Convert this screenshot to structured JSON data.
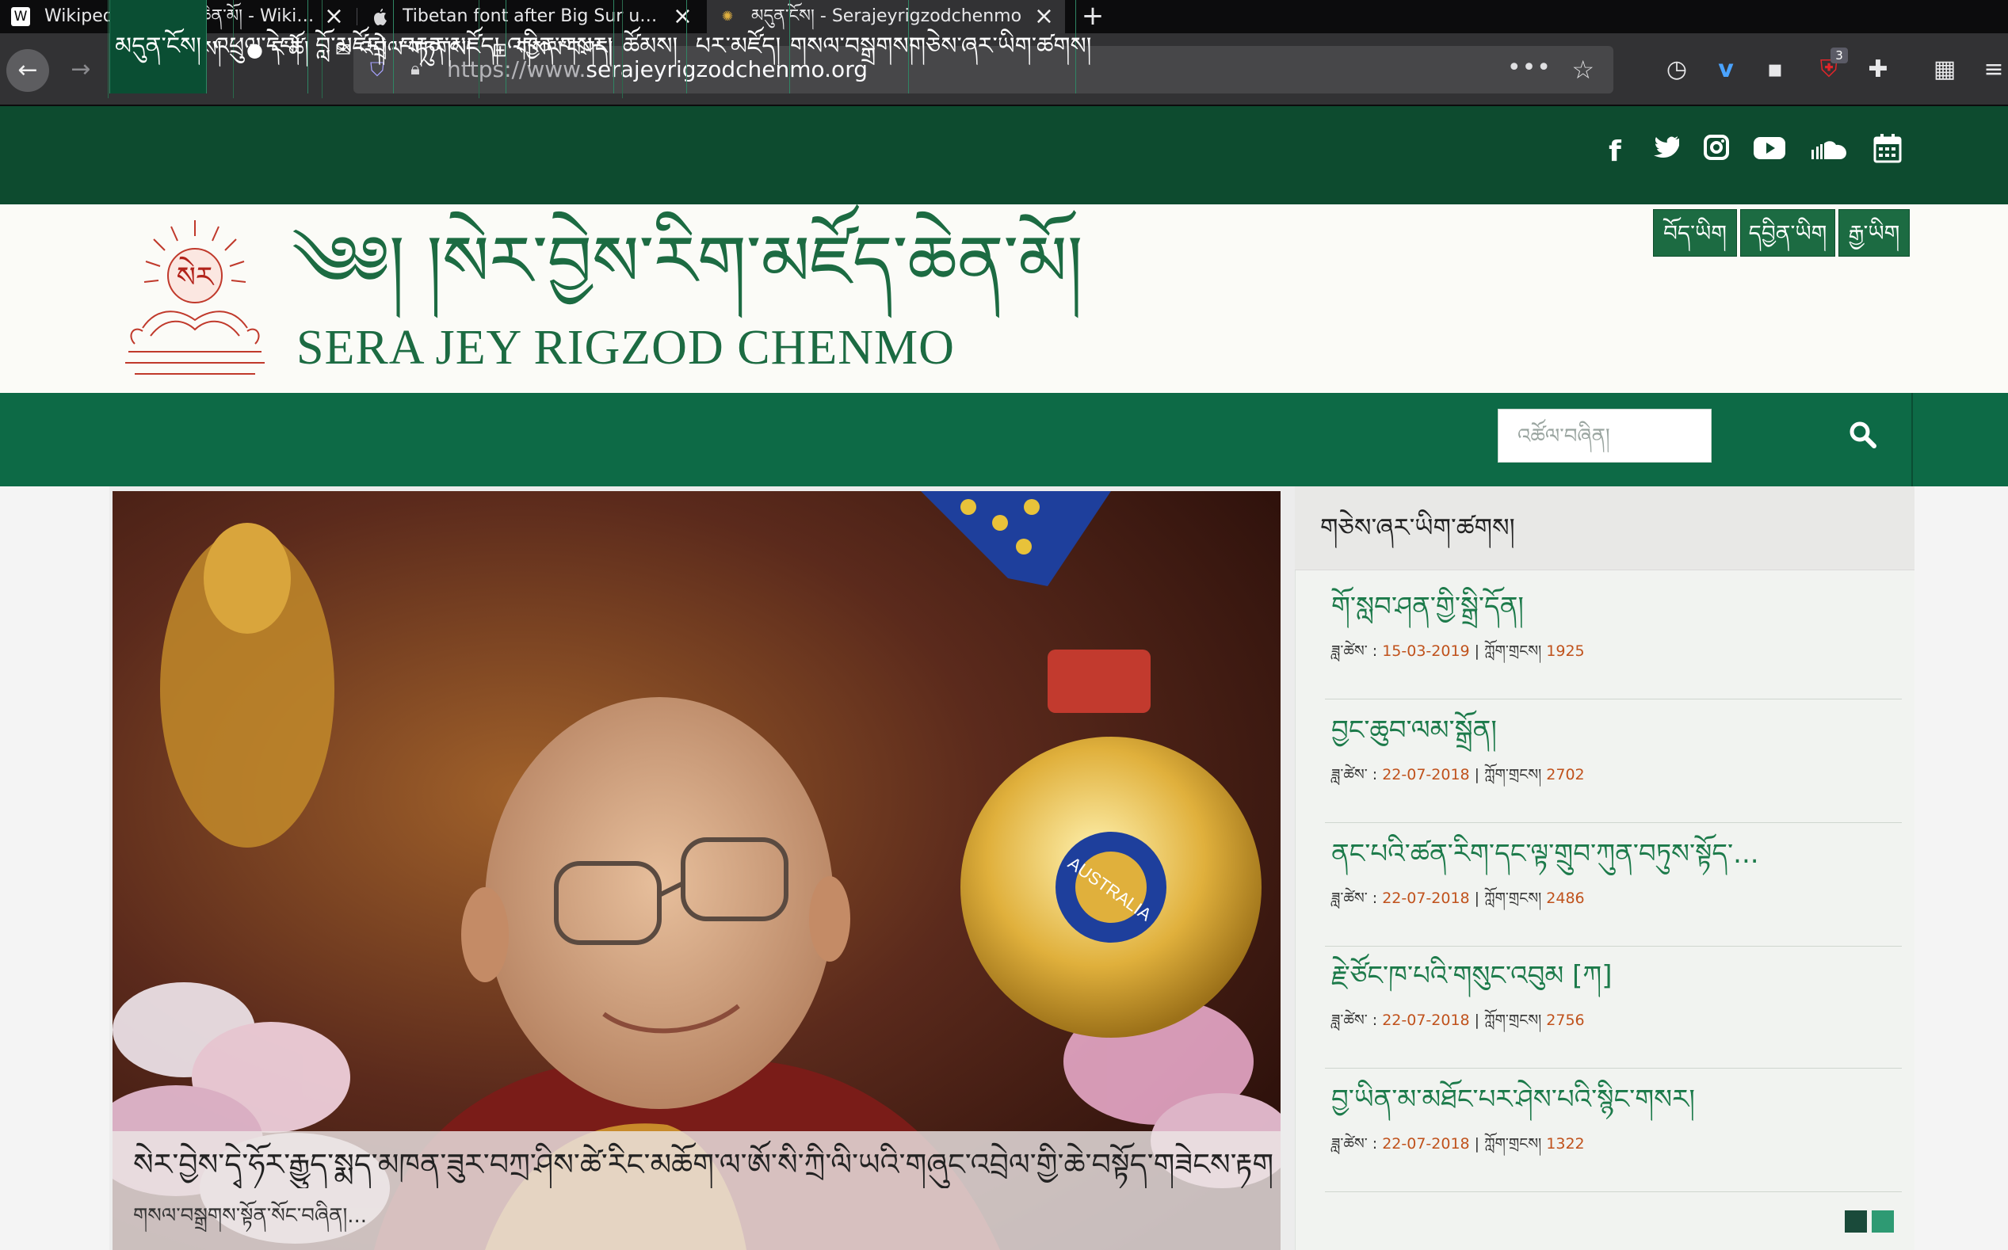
{
  "browser": {
    "tabs": [
      {
        "icon": "wikipedia-icon",
        "favicon_glyph": "W",
        "title": "Wikipedia:རིག་མཛོད་ཆེན་མོ། - Wikipedia",
        "active": false
      },
      {
        "icon": "apple-icon",
        "favicon_glyph": "",
        "title": "Tibetan font after Big Sur update",
        "active": false
      },
      {
        "icon": "sera-monastery-icon",
        "favicon_glyph": "✺",
        "title": "མདུན་ངོས། - Serajeyrigzodchenmo",
        "active": true
      }
    ],
    "new_tab_symbol": "+",
    "url_protocol": "https://www.",
    "url_domain": "serajeyrigzodchenmo.org",
    "extension_badge": "3"
  },
  "site": {
    "topnav": [
      {
        "icon": "home-icon",
        "glyph": "⌂",
        "label": "མདུན་ངོས།"
      },
      {
        "icon": "user-icon",
        "glyph": "●",
        "label": "ང་ཚོ།"
      },
      {
        "icon": "envelope-icon",
        "glyph": "✉",
        "label": "འབྲེལ་གཏུགས།"
      },
      {
        "icon": "sitemap-icon",
        "glyph": "⊞",
        "label": "གསལ་བཤད།"
      }
    ],
    "social": [
      {
        "name": "facebook-icon",
        "glyph": "f"
      },
      {
        "name": "twitter-icon",
        "glyph": "🐦"
      },
      {
        "name": "instagram-icon",
        "glyph": "◎"
      },
      {
        "name": "youtube-icon",
        "glyph": "▶"
      },
      {
        "name": "soundcloud-icon",
        "glyph": "☁"
      },
      {
        "name": "calendar-icon",
        "glyph": "▦"
      }
    ],
    "logo_tibetan": "༄༅། །སེར་བྱེས་རིག་མཛོད་ཆེན་མོ།",
    "logo_english": "SERA JEY RIGZOD CHENMO",
    "languages": [
      "བོད་ཡིག",
      "དབྱིན་ཡིག",
      "རྒྱ་ཡིག"
    ],
    "mainnav": [
      "མདུན་ངོས།",
      "འཕྲུལ་དེབ།",
      "བློ་མཛོད།",
      "བརྟན་མཛོད།",
      "འཁྱིན་གསར།",
      "ཚོམས།",
      "པར་མཛོད།",
      "གསལ་བསྒྲགས།",
      "གཅེས་ཞར་ཡིག་ཚགས།"
    ],
    "search_placeholder": "འཚོལ་བཞིན།",
    "slide": {
      "caption_title": "སེར་བྱེས་དྭེ་ཧོར་རྒྱུད་སྨད་མཁན་ཟུར་བཀྲ་ཤིས་ཚེ་རིང་མཆོག་ལ་ཨོ་སི་ཀྲི་ལི་ཡའི་གཞུང་འབྲེལ་གྱི་ཆེ་བསྟོད་གཟེངས་རྟགས་འབུལ་བཞེས་མཛད་",
      "caption_sub": "གསལ་བསྒྲགས་སྟོན་སོང་བཞིན།..."
    },
    "sidebar": {
      "title": "གཅེས་ཞར་ཡིག་ཚགས།",
      "date_label": "ཟླ་ཚེས་ :",
      "views_label": "ཀློག་གྲངས།",
      "posts": [
        {
          "title": "གོ་སླབ་ཤན་གྱི་སྒྲི་དོན།",
          "date": "15-03-2019",
          "views": "1925"
        },
        {
          "title": "བྱང་ཆུབ་ལམ་སྒྲོན།",
          "date": "22-07-2018",
          "views": "2702"
        },
        {
          "title": "ནང་པའི་ཚན་རིག་དང་ལྟ་གྲུབ་ཀུན་བཏུས་སྟོད་...",
          "date": "22-07-2018",
          "views": "2486"
        },
        {
          "title": "རྗེ་ཙོང་ཁ་པའི་གསུང་འབུམ [ཀ]",
          "date": "22-07-2018",
          "views": "2756"
        },
        {
          "title": "བྱ་ཡིན་མ་མཐོང་པར་ཤེས་པའི་སྙིང་གསར།",
          "date": "22-07-2018",
          "views": "1322"
        }
      ]
    }
  },
  "colors": {
    "dark_green": "#0d4b2f",
    "nav_green": "#0d6a46",
    "logo_green": "#1c6b42",
    "meta_orange": "#c0521c"
  }
}
